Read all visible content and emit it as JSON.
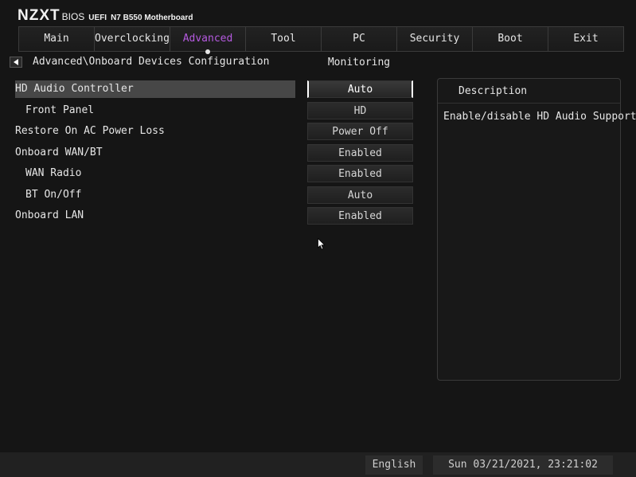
{
  "brand": {
    "logo": "NZXT",
    "bios": "BIOS",
    "uefi": "UEFI",
    "board": "N7 B550 Motherboard"
  },
  "tabs": [
    {
      "label": "Main",
      "active": false
    },
    {
      "label": "Overclocking",
      "active": false
    },
    {
      "label": "Advanced",
      "active": true
    },
    {
      "label": "Tool",
      "active": false
    },
    {
      "label": "PC Monitoring",
      "active": false
    },
    {
      "label": "Security",
      "active": false
    },
    {
      "label": "Boot",
      "active": false
    },
    {
      "label": "Exit",
      "active": false
    }
  ],
  "breadcrumb": "Advanced\\Onboard Devices Configuration",
  "settings": [
    {
      "label": "HD Audio Controller",
      "value": "Auto",
      "indent": false,
      "selected": true
    },
    {
      "label": "Front Panel",
      "value": "HD",
      "indent": true,
      "selected": false
    },
    {
      "label": "Restore On AC Power Loss",
      "value": "Power Off",
      "indent": false,
      "selected": false
    },
    {
      "label": "Onboard WAN/BT",
      "value": "Enabled",
      "indent": false,
      "selected": false
    },
    {
      "label": "WAN Radio",
      "value": "Enabled",
      "indent": true,
      "selected": false
    },
    {
      "label": "BT On/Off",
      "value": "Auto",
      "indent": true,
      "selected": false
    },
    {
      "label": "Onboard LAN",
      "value": "Enabled",
      "indent": false,
      "selected": false
    }
  ],
  "description": {
    "title": "Description",
    "text": "Enable/disable HD Audio Support"
  },
  "footer": {
    "language": "English",
    "datetime": "Sun 03/21/2021, 23:21:02"
  },
  "colors": {
    "accent": "#b55ae0",
    "background": "#151515",
    "selection": "#474747"
  },
  "icons": {
    "back": "back-arrow-icon",
    "cursor": "mouse-pointer-icon"
  }
}
